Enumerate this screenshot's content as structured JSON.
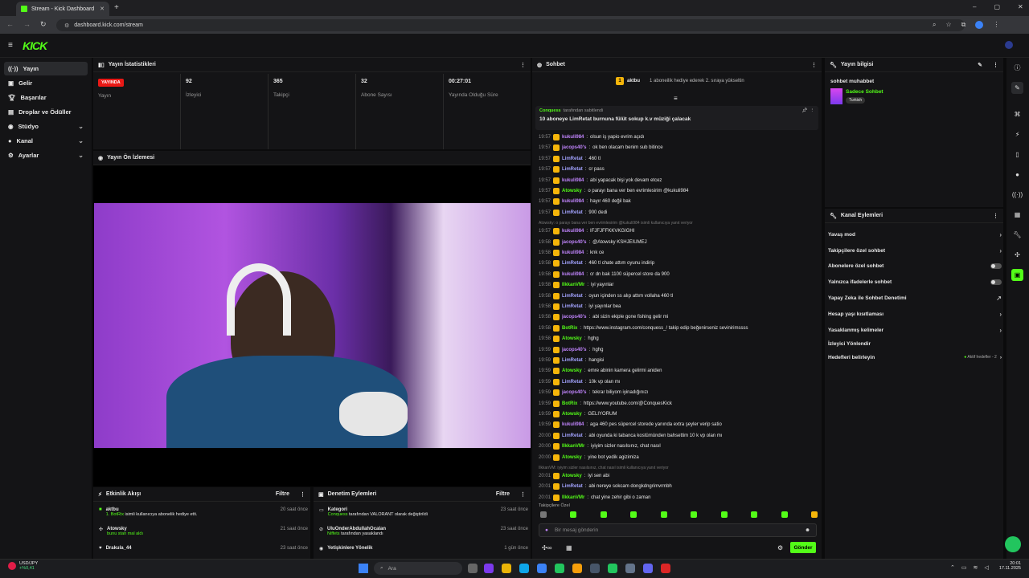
{
  "browser": {
    "tab_title": "Stream - Kick Dashboard",
    "url": "dashboard.kick.com/stream"
  },
  "app": {
    "logo": "KICK",
    "brand_color": "#53fc18"
  },
  "sidebar": {
    "items": [
      {
        "label": "Yayın",
        "active": true
      },
      {
        "label": "Gelir"
      },
      {
        "label": "Başarılar"
      },
      {
        "label": "Droplar ve Ödüller"
      },
      {
        "label": "Stüdyo",
        "chevron": true
      },
      {
        "label": "Kanal",
        "chevron": true
      },
      {
        "label": "Ayarlar",
        "chevron": true
      }
    ]
  },
  "stats": {
    "title": "Yayın İstatistikleri",
    "live_badge": "YAYINDA",
    "live_label": "Yayın",
    "items": [
      {
        "value": "92",
        "label": "İzleyici"
      },
      {
        "value": "365",
        "label": "Takipçi"
      },
      {
        "value": "32",
        "label": "Abone Sayısı"
      },
      {
        "value": "00:27:01",
        "label": "Yayında Olduğu Süre"
      }
    ]
  },
  "preview": {
    "title": "Yayın Ön İzlemesi"
  },
  "activity": {
    "title": "Etkinlik Akışı",
    "filter": "Filtre",
    "rows": [
      {
        "user": "aktbu",
        "detail_user": "1. BotRix",
        "detail": "isimli kullanıcıya abonelik hediye etti.",
        "time": "20 saat önce"
      },
      {
        "user": "Atowsky",
        "detail_user": "",
        "detail": "bunu stan mal aldı",
        "time": "21 saat önce"
      },
      {
        "user": "Drakula_44",
        "detail_user": "",
        "detail": "",
        "time": "23 saat önce"
      }
    ]
  },
  "moderation": {
    "title": "Denetim Eylemleri",
    "filter": "Filtre",
    "rows": [
      {
        "title": "Kategori",
        "detail_user": "Conquess",
        "detail": "tarafından VALORANT olarak değiştirildi",
        "time": "23 saat önce"
      },
      {
        "title": "UluOnderAbdullahOcalan",
        "detail_user": "Niffets",
        "detail": "tarafından yasaklandı",
        "time": "23 saat önce"
      },
      {
        "title": "Yetişkinlere Yönelik",
        "detail_user": "",
        "detail": "",
        "time": "1 gün önce"
      }
    ]
  },
  "chat": {
    "title": "Sohbet",
    "gift_user": "aktbu",
    "gift_count": "1",
    "gift_text": "1 aboneilik hediye ederek 2. sıraya yükseltin",
    "pinned_by": "Conquess",
    "pinned_by_suffix": "tarafından sabitlendi",
    "pinned_msg": "10 aboneye LimRetat burnuna fülüt sokup k.v müziği çalacak",
    "messages": [
      {
        "time": "19:57",
        "user": "kukuli984",
        "color": "#c084fc",
        "text": "olsun iş yapio evrim açıdı"
      },
      {
        "time": "19:57",
        "user": "jacops40's",
        "color": "#c084fc",
        "text": "ok ben olacam benim sub bitince"
      },
      {
        "time": "19:57",
        "user": "LimRetat",
        "color": "#a3a3ff",
        "text": "460 tl"
      },
      {
        "time": "19:57",
        "user": "LimRetat",
        "color": "#a3a3ff",
        "text": "cr pass"
      },
      {
        "time": "19:57",
        "user": "kukuli984",
        "color": "#c084fc",
        "text": "abi yapacak bişi yok devam etcez"
      },
      {
        "time": "19:57",
        "user": "Atowsky",
        "color": "#53fc18",
        "text": "o parayı bana ver ben evrimlesirim @kukuli984"
      },
      {
        "time": "19:57",
        "user": "kukuli984",
        "color": "#c084fc",
        "text": "hayır 460 değil bak"
      },
      {
        "time": "19:57",
        "user": "LimRetat",
        "color": "#a3a3ff",
        "text": "900 dedi"
      },
      {
        "time": "",
        "user": "",
        "color": "#777",
        "text": "Atowsky: o parayı bana ver ben evrimlesirim @kukuli984 isimli kullanıcıya yanıt veriyor"
      },
      {
        "time": "19:57",
        "user": "kukuli984",
        "color": "#c084fc",
        "text": "IFJFJFFKKVKGIGHI"
      },
      {
        "time": "19:58",
        "user": "jacops40's",
        "color": "#c084fc",
        "text": "@Atowsky KSHJEIUMEJ"
      },
      {
        "time": "19:58",
        "user": "kukuli984",
        "color": "#c084fc",
        "text": "knk ce"
      },
      {
        "time": "19:58",
        "user": "LimRetat",
        "color": "#a3a3ff",
        "text": "460 tl chate attım oyunu indirip"
      },
      {
        "time": "19:58",
        "user": "kukuli984",
        "color": "#c084fc",
        "text": "cr dn bak 1100 süpercel store da 900"
      },
      {
        "time": "19:58",
        "user": "IlkkanVMr",
        "color": "#53fc18",
        "text": "iyi yayınlar"
      },
      {
        "time": "19:58",
        "user": "LimRetat",
        "color": "#a3a3ff",
        "text": "oyun içinden ss alıp attım vollaha 460 tl"
      },
      {
        "time": "19:58",
        "user": "LimRetat",
        "color": "#a3a3ff",
        "text": "iyi yayınlar bea"
      },
      {
        "time": "19:58",
        "user": "jacops40's",
        "color": "#c084fc",
        "text": "abi sizin ekiple gone fishing gelir mi"
      },
      {
        "time": "19:58",
        "user": "BotRix",
        "color": "#53fc18",
        "text": "https://www.instagram.com/conquess_/ takip edip beğenirseniz sevinirimssss"
      },
      {
        "time": "19:58",
        "user": "Atowsky",
        "color": "#53fc18",
        "text": "hghg"
      },
      {
        "time": "19:59",
        "user": "jacops40's",
        "color": "#c084fc",
        "text": "hghg"
      },
      {
        "time": "19:59",
        "user": "LimRetat",
        "color": "#a3a3ff",
        "text": "hangisi"
      },
      {
        "time": "19:59",
        "user": "Atowsky",
        "color": "#53fc18",
        "text": "emre abinin kamera gelirmi aniden"
      },
      {
        "time": "19:59",
        "user": "LimRetat",
        "color": "#a3a3ff",
        "text": "10k vp olan mı"
      },
      {
        "time": "19:59",
        "user": "jacops40's",
        "color": "#c084fc",
        "text": "tekrar biliyom iyinadığınızı"
      },
      {
        "time": "19:59",
        "user": "BotRix",
        "color": "#53fc18",
        "text": "https://www.youtube.com/@ConquesKick"
      },
      {
        "time": "19:59",
        "user": "Atowsky",
        "color": "#53fc18",
        "text": "GELIYORUM"
      },
      {
        "time": "19:59",
        "user": "kukuli984",
        "color": "#c084fc",
        "text": "aga 460 pes süpercel storede yanında extra şeyler verip satio"
      },
      {
        "time": "20:00",
        "user": "LimRetat",
        "color": "#a3a3ff",
        "text": "abi oyunda ki tabanca kostümünden bahsettim 10 k vp olan mı"
      },
      {
        "time": "20:00",
        "user": "IlkkanVMr",
        "color": "#53fc18",
        "text": "iyiyim sizler nasılsınız, chat nasıl"
      },
      {
        "time": "20:00",
        "user": "Atowsky",
        "color": "#53fc18",
        "text": "yine bot yedik agizimiza"
      },
      {
        "time": "",
        "user": "",
        "color": "#777",
        "text": "IlkkanVM: iyiyim sizler nasılsınız, chat nasıl isimli kullanıcıya yanıt veriyor"
      },
      {
        "time": "20:01",
        "user": "Atowsky",
        "color": "#53fc18",
        "text": "iyi sen abi"
      },
      {
        "time": "20:01",
        "user": "LimRetat",
        "color": "#a3a3ff",
        "text": "abi nereye sokcam dongkdngrimvrmbh"
      },
      {
        "time": "20:01",
        "user": "IlkkanVMr",
        "color": "#53fc18",
        "text": "chat yine zehir gibi o zaman"
      }
    ],
    "followers_only": "Takipçilere Özel",
    "input_placeholder": "Bir mesaj gönderin",
    "send_label": "Gönder"
  },
  "stream_info": {
    "title": "Yayın bilgisi",
    "stream_title": "sohbet muhabbet",
    "category": "Sadece Sohbet",
    "tag": "Turkish"
  },
  "channel_actions": {
    "title": "Kanal Eylemleri",
    "items": [
      {
        "label": "Yavaş mod",
        "ctrl": "chevron"
      },
      {
        "label": "Takipçilere özel sohbet",
        "ctrl": "chevron"
      },
      {
        "label": "Abonelere özel sohbet",
        "ctrl": "toggle"
      },
      {
        "label": "Yalnızca ifadelerle sohbet",
        "ctrl": "toggle"
      },
      {
        "label": "Yapay Zeka ile Sohbet Denetimi",
        "ctrl": "external"
      },
      {
        "label": "Hesap yaşı kısıtlaması",
        "ctrl": "chevron"
      },
      {
        "label": "Yasaklanmış kelimeler",
        "ctrl": "chevron"
      },
      {
        "label": "İzleyici Yönlendir",
        "ctrl": "none"
      },
      {
        "label": "Hedefleri belirleyin",
        "ctrl": "chevron",
        "badge": "Aktif hedefler - 2"
      }
    ]
  },
  "taskbar": {
    "ticker": "USD/JPY",
    "ticker_change": "+%0,41",
    "search": "Ara",
    "time": "20:01",
    "date": "17.11.2025"
  }
}
